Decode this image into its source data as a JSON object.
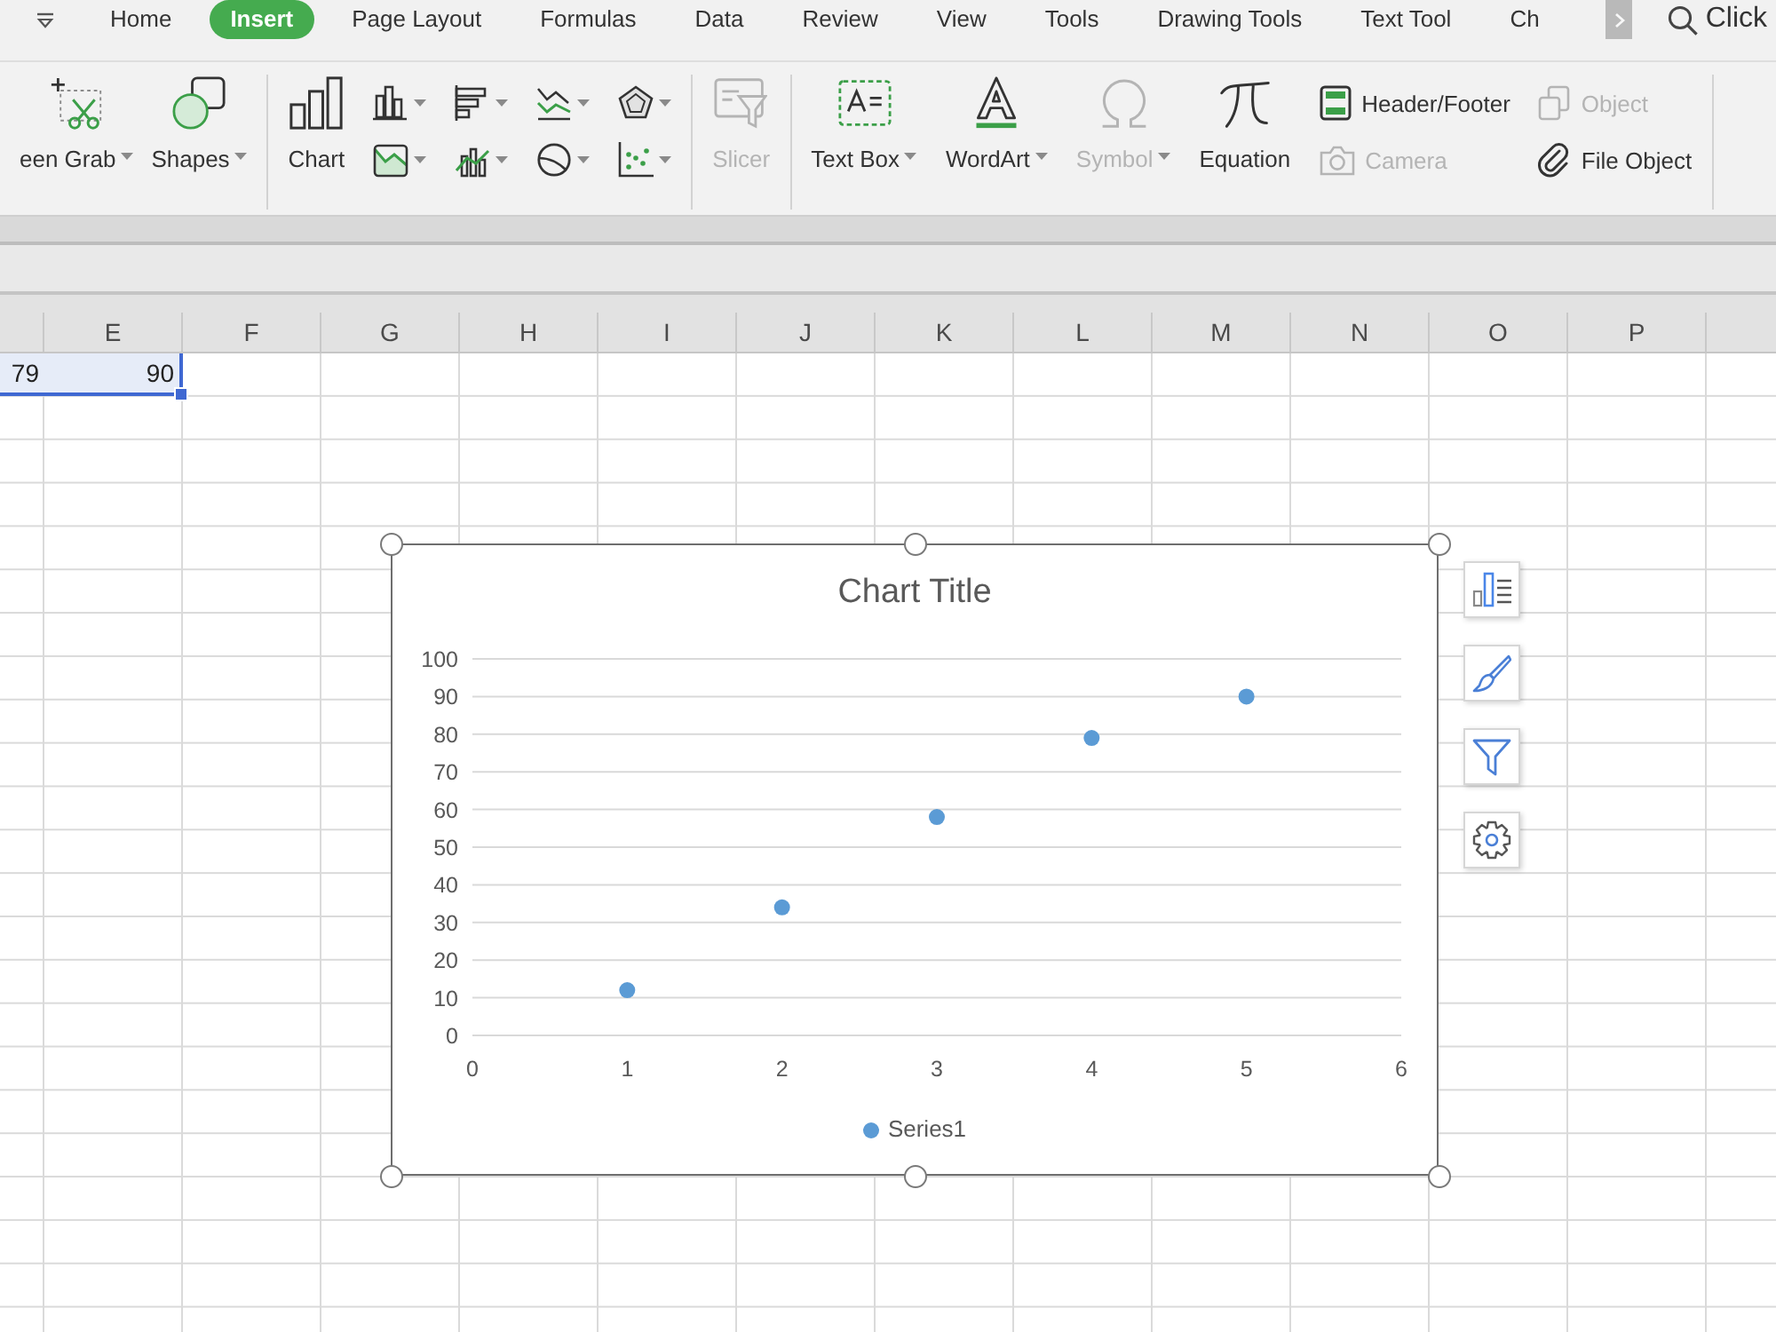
{
  "menu_bar": {
    "tabs": [
      {
        "label": "Home",
        "selected": false
      },
      {
        "label": "Insert",
        "selected": true
      },
      {
        "label": "Page Layout",
        "selected": false
      },
      {
        "label": "Formulas",
        "selected": false
      },
      {
        "label": "Data",
        "selected": false
      },
      {
        "label": "Review",
        "selected": false
      },
      {
        "label": "View",
        "selected": false
      },
      {
        "label": "Tools",
        "selected": false
      },
      {
        "label": "Drawing Tools",
        "selected": false
      },
      {
        "label": "Text Tool",
        "selected": false
      },
      {
        "label": "Ch",
        "selected": false
      }
    ],
    "search": {
      "label": "Click"
    }
  },
  "ribbon": {
    "groups": [
      {
        "items": [
          {
            "kind": "large",
            "label": "een Grab",
            "dropdown": true,
            "disabled": false
          },
          {
            "kind": "large",
            "label": "Shapes",
            "dropdown": true,
            "disabled": false
          }
        ]
      },
      {
        "items": [
          {
            "kind": "large",
            "label": "Chart",
            "dropdown": false,
            "disabled": false
          },
          {
            "kind": "icon",
            "dropdown": true,
            "disabled": false
          },
          {
            "kind": "icon",
            "dropdown": true,
            "disabled": false
          },
          {
            "kind": "icon",
            "dropdown": true,
            "disabled": false
          },
          {
            "kind": "icon",
            "dropdown": true,
            "disabled": false
          },
          {
            "kind": "icon",
            "dropdown": true,
            "disabled": false
          },
          {
            "kind": "icon",
            "dropdown": true,
            "disabled": false
          },
          {
            "kind": "icon",
            "dropdown": true,
            "disabled": false
          },
          {
            "kind": "icon",
            "dropdown": true,
            "disabled": false
          }
        ]
      },
      {
        "items": [
          {
            "kind": "large",
            "label": "Slicer",
            "dropdown": false,
            "disabled": true
          }
        ]
      },
      {
        "items": [
          {
            "kind": "large",
            "label": "Text Box",
            "dropdown": true,
            "disabled": false
          },
          {
            "kind": "large",
            "label": "WordArt",
            "dropdown": true,
            "disabled": false
          },
          {
            "kind": "large",
            "label": "Symbol",
            "dropdown": true,
            "disabled": true
          },
          {
            "kind": "large",
            "label": "Equation",
            "dropdown": false,
            "disabled": false
          },
          {
            "kind": "small",
            "label": "Header/Footer",
            "dropdown": false,
            "disabled": false
          },
          {
            "kind": "small",
            "label": "Camera",
            "dropdown": false,
            "disabled": true
          },
          {
            "kind": "small",
            "label": "Object",
            "dropdown": false,
            "disabled": true
          },
          {
            "kind": "small",
            "label": "File Object",
            "dropdown": false,
            "disabled": false
          }
        ]
      }
    ]
  },
  "sheet": {
    "columns": [
      "E",
      "F",
      "G",
      "H",
      "I",
      "J",
      "K",
      "L",
      "M",
      "N",
      "O",
      "P"
    ],
    "rows": [
      {
        "cells": [
          {
            "text": "79",
            "selected": true
          },
          {
            "text": "90",
            "selected": true
          }
        ]
      }
    ],
    "chart": {
      "chart_data": {
        "type": "scatter",
        "title": "Chart Title",
        "x": [
          1,
          2,
          3,
          4,
          5
        ],
        "series": [
          {
            "name": "Series1",
            "color": "#5b9bd5",
            "values": [
              12,
              34,
              58,
              79,
              90
            ]
          }
        ],
        "xlim": [
          0,
          6
        ],
        "ylim": [
          0,
          100
        ],
        "xticks": [
          0,
          1,
          2,
          3,
          4,
          5,
          6
        ],
        "yticks": [
          0,
          10,
          20,
          30,
          40,
          50,
          60,
          70,
          80,
          90,
          100
        ],
        "grid": true,
        "legend": "bottom"
      }
    }
  }
}
